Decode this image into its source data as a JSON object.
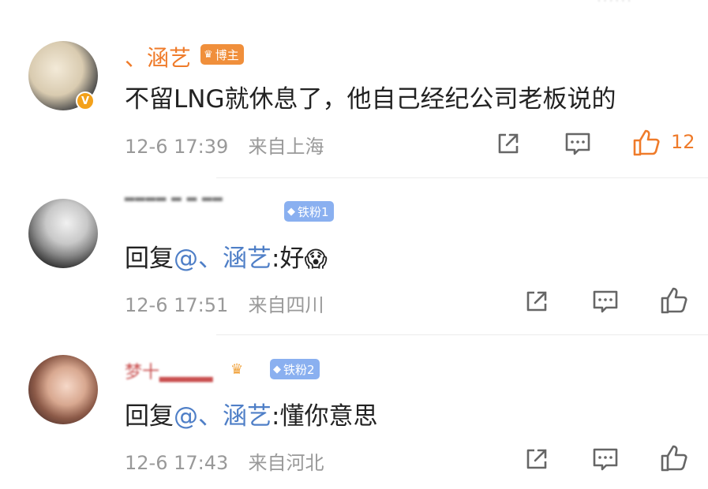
{
  "comments": [
    {
      "username": "、涵艺",
      "badge": "博主",
      "avatar_badge": "V",
      "text": "不留LNG就休息了，他自己经纪公司老板说的",
      "time": "12-6 17:39",
      "location": "来自上海",
      "likes": "12",
      "liked": true
    },
    {
      "username": "▂▂▂▂ ▂ ▂ ▂▂",
      "badge": "铁粉1",
      "reply_prefix": "回复",
      "mention": "@、涵艺",
      "reply_text": ":好",
      "emoji": "😱",
      "time": "12-6 17:51",
      "location": "来自四川"
    },
    {
      "username": "梦十▂▂▂▂",
      "badge": "铁粉2",
      "reply_prefix": "回复",
      "mention": "@、涵艺",
      "reply_text": ":懂你意思",
      "time": "12-6 17:43",
      "location": "来自河北"
    }
  ],
  "icons": {
    "share": "share-icon",
    "comment": "comment-icon",
    "like": "thumbs-up-icon",
    "fan_badge": "diamond-icon",
    "blogger_badge": "crown-icon"
  },
  "colors": {
    "accent": "#ef7b2a",
    "mention": "#4f7fc7",
    "meta": "#999999",
    "fan_badge": "#8ab0f0",
    "blogger_badge": "#f08f3b"
  }
}
